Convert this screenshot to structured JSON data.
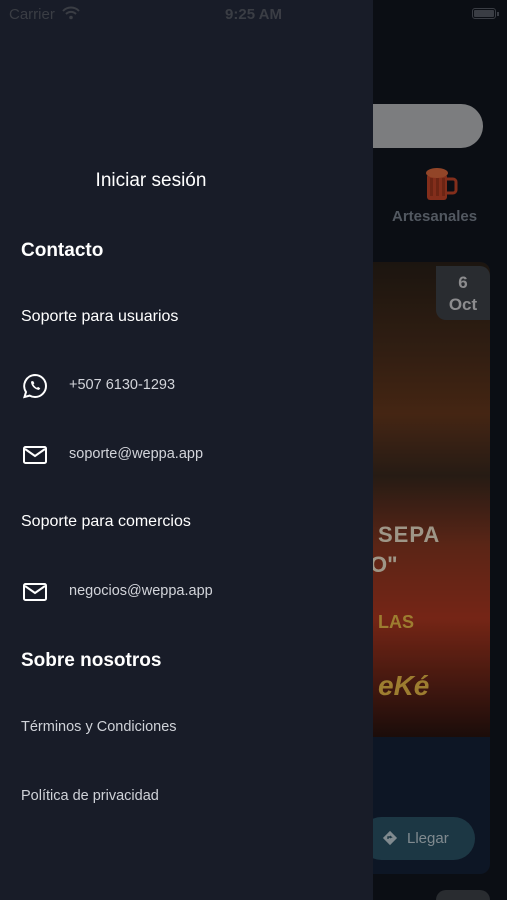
{
  "status_bar": {
    "carrier": "Carrier",
    "time": "9:25 AM",
    "battery_level": 1.0
  },
  "drawer": {
    "login_label": "Iniciar sesión",
    "contact_heading": "Contacto",
    "user_support_heading": "Soporte para usuarios",
    "whatsapp_phone": "+507 6130-1293",
    "support_email": "soporte@weppa.app",
    "business_support_heading": "Soporte para comercios",
    "business_email": "negocios@weppa.app",
    "about_heading": "Sobre nosotros",
    "terms_link": "Términos y Condiciones",
    "privacy_link": "Política de privacidad"
  },
  "background": {
    "category_label": "Artesanales",
    "event_date_day": "6",
    "event_date_month": "Oct",
    "poster_line1": "SEPA",
    "poster_line2": "O\"",
    "poster_line3": "LAS",
    "poster_line4": "eKé",
    "directions_button": "Llegar",
    "accent_color": "#d2502a"
  }
}
